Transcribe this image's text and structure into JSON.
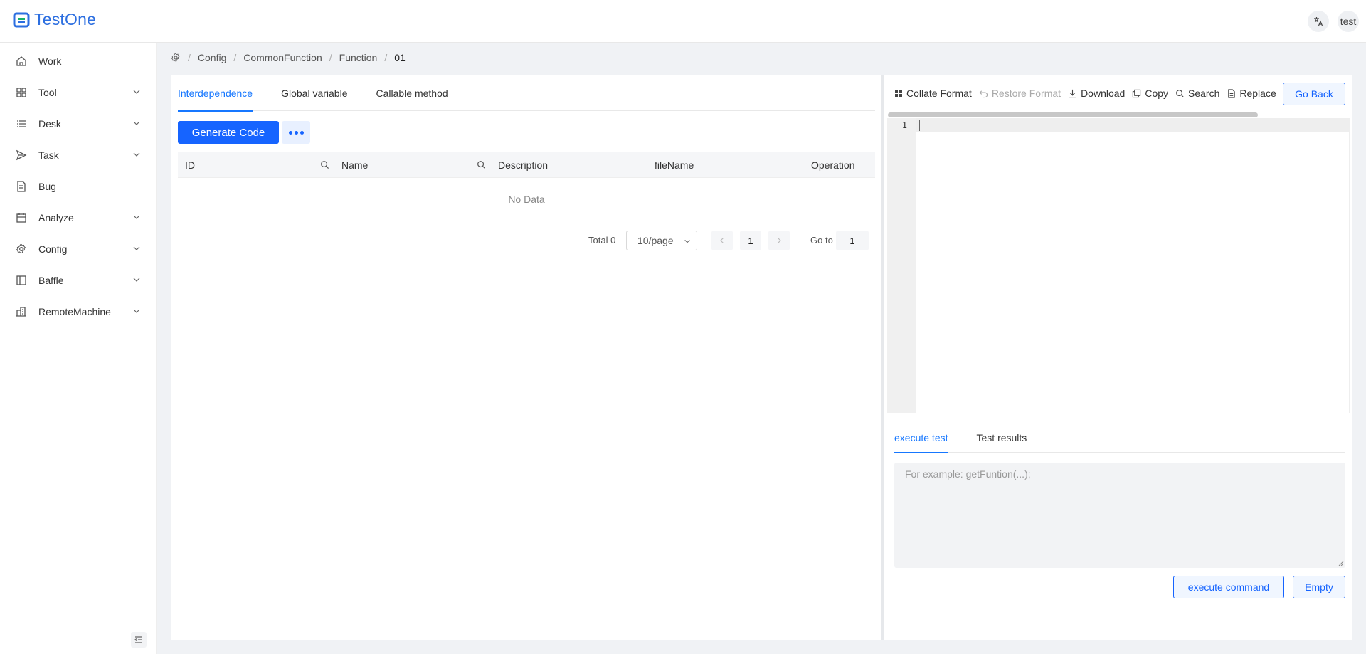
{
  "app": {
    "title": "TestOne",
    "user": "test",
    "translate_icon": "translate-icon"
  },
  "sidebar": {
    "items": [
      {
        "label": "Work",
        "icon": "home-icon",
        "expandable": false
      },
      {
        "label": "Tool",
        "icon": "grid-icon",
        "expandable": true
      },
      {
        "label": "Desk",
        "icon": "list-icon",
        "expandable": true
      },
      {
        "label": "Task",
        "icon": "send-icon",
        "expandable": true
      },
      {
        "label": "Bug",
        "icon": "file-icon",
        "expandable": false
      },
      {
        "label": "Analyze",
        "icon": "calendar-icon",
        "expandable": true
      },
      {
        "label": "Config",
        "icon": "gear-icon",
        "expandable": true
      },
      {
        "label": "Baffle",
        "icon": "layout-icon",
        "expandable": true
      },
      {
        "label": "RemoteMachine",
        "icon": "building-icon",
        "expandable": true
      }
    ]
  },
  "breadcrumb": {
    "items": [
      "Config",
      "CommonFunction",
      "Function",
      "01"
    ]
  },
  "left": {
    "tabs": [
      "Interdependence",
      "Global variable",
      "Callable method"
    ],
    "generate_label": "Generate Code",
    "table": {
      "columns": [
        "ID",
        "Name",
        "Description",
        "fileName",
        "Operation"
      ],
      "empty_text": "No Data"
    },
    "pagination": {
      "total_label": "Total 0",
      "page_size": "10/page",
      "current_page": "1",
      "goto_label": "Go to",
      "goto_value": "1"
    }
  },
  "right": {
    "toolbar": {
      "collate": "Collate Format",
      "restore": "Restore Format",
      "download": "Download",
      "copy": "Copy",
      "search": "Search",
      "replace": "Replace"
    },
    "go_back": "Go Back",
    "editor": {
      "line_number": "1"
    },
    "bottom_tabs": [
      "execute test",
      "Test results"
    ],
    "command_placeholder": "For example:  getFuntion(...);",
    "execute_label": "execute command",
    "empty_label": "Empty"
  },
  "colors": {
    "primary": "#1664ff",
    "tab_active": "#1677ff",
    "logo": "#2d6fe0"
  }
}
